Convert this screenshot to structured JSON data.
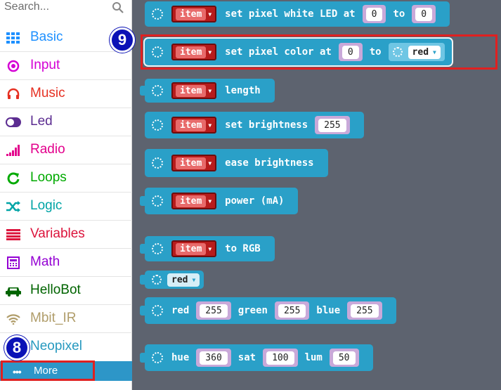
{
  "search": {
    "placeholder": "Search..."
  },
  "categories": [
    {
      "label": "Basic",
      "icon": "grid-icon",
      "color": "#1e90ff"
    },
    {
      "label": "Input",
      "icon": "target-icon",
      "color": "#d400d4"
    },
    {
      "label": "Music",
      "icon": "headphones-icon",
      "color": "#e63022"
    },
    {
      "label": "Led",
      "icon": "toggle-icon",
      "color": "#5c2d91"
    },
    {
      "label": "Radio",
      "icon": "signal-bars-icon",
      "color": "#e3008c"
    },
    {
      "label": "Loops",
      "icon": "refresh-icon",
      "color": "#00aa00"
    },
    {
      "label": "Logic",
      "icon": "shuffle-icon",
      "color": "#00a4a6"
    },
    {
      "label": "Variables",
      "icon": "list-lines-icon",
      "color": "#dc143c"
    },
    {
      "label": "Math",
      "icon": "calculator-icon",
      "color": "#9400d3"
    },
    {
      "label": "HelloBot",
      "icon": "car-icon",
      "color": "#006400"
    },
    {
      "label": "Mbit_IR",
      "icon": "wifi-icon",
      "color": "#b09d6a"
    },
    {
      "label": "Neopixel",
      "icon": "neopixel-icon",
      "color": "#2699bf"
    }
  ],
  "more": {
    "label": "More",
    "dots": "•••"
  },
  "badges": {
    "nine": "9",
    "eight": "8"
  },
  "blocks": {
    "b1": {
      "item": "item",
      "text": "set pixel white LED at",
      "v1": "0",
      "to": "to",
      "v2": "0"
    },
    "b2": {
      "item": "item",
      "text": "set pixel color at",
      "v1": "0",
      "to": "to",
      "color": "red"
    },
    "b3": {
      "item": "item",
      "text": "length"
    },
    "b4": {
      "item": "item",
      "text": "set brightness",
      "v1": "255"
    },
    "b5": {
      "item": "item",
      "text": "ease brightness"
    },
    "b6": {
      "item": "item",
      "text": "power (mA)"
    },
    "b7": {
      "item": "item",
      "text": "to RGB"
    },
    "b8": {
      "color": "red"
    },
    "b9": {
      "red": "red",
      "rv": "255",
      "green": "green",
      "gv": "255",
      "blue": "blue",
      "bv": "255"
    },
    "b10": {
      "hue": "hue",
      "hv": "360",
      "sat": "sat",
      "sv": "100",
      "lum": "lum",
      "lv": "50"
    }
  },
  "colors": {
    "block": "#2aa0c8",
    "workspace": "#5d636f",
    "highlight": "#e02020",
    "badge": "#0b12b6"
  }
}
